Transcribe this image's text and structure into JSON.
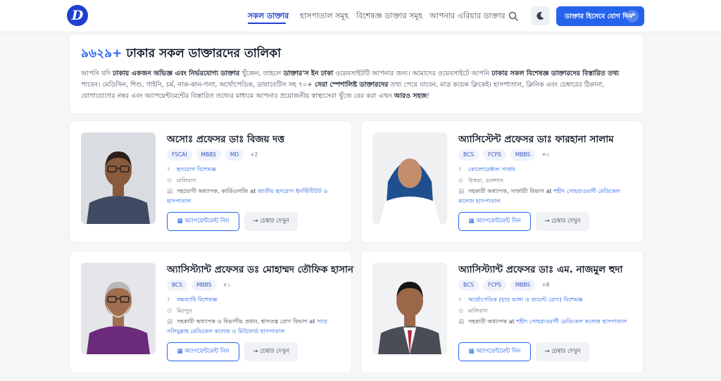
{
  "header": {
    "logo_letter": "D",
    "nav": [
      {
        "label": "সকল ডাক্তার",
        "active": true
      },
      {
        "label": "হাসপাতাল সমূহ",
        "active": false
      },
      {
        "label": "বিশেষজ্ঞ ডাক্তার সমূহ",
        "active": false
      },
      {
        "label": "আপনার এরিয়ার ডাক্তার",
        "active": false
      }
    ],
    "cta_label": "ডাক্তার হিসেবে যোগ দিন",
    "cta_arrow": "↗"
  },
  "hero": {
    "count": "৯৬২৯+",
    "title_rest": " ঢাকার সকল ডাক্তারদের তালিকা",
    "desc": [
      {
        "t": "আপনি যদি ",
        "b": false
      },
      {
        "t": "ঢাকায় একজন অভিজ্ঞ এবং নির্ভরযোগ্য ডাক্তার",
        "b": true
      },
      {
        "t": " খুঁজেন, তাহলে ",
        "b": false
      },
      {
        "t": "ডাক্তার'স ইন ঢাকা",
        "b": true
      },
      {
        "t": " ওয়েবসাইটটি আপনার জন্য। আমাদের ওয়েবসাইটে আপনি ",
        "b": false
      },
      {
        "t": "ঢাকার সকল বিশেষজ্ঞ ডাক্তারদের বিস্তারিত তথ্য",
        "b": true
      },
      {
        "t": " পাবেন। মেডিসিন, শিশু, গাইনি, চর্ম, নাক-কান-গলা, অর্থোপেডিক, ডায়াবেটিস সহ ৭০+ ",
        "b": false
      },
      {
        "t": "সেরা স্পেশালিষ্ট ডাক্তারদের",
        "b": true
      },
      {
        "t": " তথ্য পেয়ে যাবেন, মাত্র কয়েক ক্লিকেই। হাসপাতাল, ক্লিনিক এবং চেম্বারের ঠিকানা, যোগাযোগের নম্বর এবং অ্যাপয়েন্টমেন্টের বিস্তারিত তথ্যের মাধ্যমে আপনার প্রয়োজনীয় স্বাস্থ্যসেবা খুঁজে বের করা এখন ",
        "b": false
      },
      {
        "t": "আরও সহজ",
        "b": true
      },
      {
        "t": "!",
        "b": false
      }
    ]
  },
  "doctors": [
    {
      "name": "অসোঃ প্রফেসর ডাঃ বিজয় দত্ত",
      "badges": [
        "FSCAI",
        "MBBS",
        "MD"
      ],
      "more": "+2",
      "specialty": "হৃদরোগ বিশেষজ্ঞ",
      "location": "মালিবাগ",
      "work_prefix": "সহযোগী অধ্যাপক, কার্ডিওলজি",
      "work_at": " at ",
      "work_inst": "জাতীয় হৃদরোগ ইনস্টিটিউট ও হাসপাতাল",
      "appointment_label": "অ্যাপয়েন্টমেন্ট নিন",
      "chamber_label": "চেম্বার দেখুন",
      "photo": {
        "bg": "#d9dde2",
        "skin": "#8a5a3c",
        "hair": "#2a2018",
        "cloth": "#3f4b63",
        "glasses": true,
        "beard": false,
        "hijab": false,
        "coat": false
      }
    },
    {
      "name": "অ্যাসিস্টেন্ট প্রফেসর ডাঃ ফারহানা সালাম",
      "badges": [
        "BCS",
        "FCPS",
        "MBBS"
      ],
      "more": "+৩",
      "specialty": "কোলোরেক্টাল সার্জন",
      "location": "উত্তরা, গুলশান",
      "work_prefix": "সহকারী অধ্যাপক, সার্জারী বিভাগ",
      "work_at": " at ",
      "work_inst": "শহীদ সোহরাওয়ার্দী মেডিকেল কলেজ হাসপাতাল",
      "appointment_label": "অ্যাপয়েন্টমেন্ট নিন",
      "chamber_label": "চেম্বার দেখুন",
      "photo": {
        "bg": "#eef0f2",
        "skin": "#c48e6c",
        "hair": "#1f4f8f",
        "cloth": "#ffffff",
        "glasses": false,
        "beard": false,
        "hijab": true,
        "coat": true
      }
    },
    {
      "name": "অ্যাসিস্ট্যান্ট প্রফেসর ডঃ মোহাম্মদ তৌফিক হাসান",
      "badges": [
        "BCS",
        "MBBS"
      ],
      "more": "+১",
      "specialty": "বক্ষব্যাধি বিশেষজ্ঞ",
      "location": "মিরপুর",
      "work_prefix": "সহকারী অধ্যাপক ও বিভাগীয় প্রধান, শ্বাসতন্ত্র রোগ বিভাগ",
      "work_at": " at ",
      "work_inst": "স্যার সলিমুল্লাহ মেডিকেল কলেজ ও মিটফোর্ড হাসপাতাল",
      "appointment_label": "অ্যাপয়েন্টমেন্ট নিন",
      "chamber_label": "চেম্বার দেখুন",
      "photo": {
        "bg": "#e4e6e9",
        "skin": "#a06f50",
        "hair": "#b8b8b8",
        "cloth": "#6b2a7a",
        "glasses": true,
        "beard": true,
        "hijab": false,
        "coat": false
      }
    },
    {
      "name": "অ্যাসিস্ট্যান্ট প্রফেসর ডাঃ এম. নাজমুল হুদা",
      "badges": [
        "BCS",
        "FCPS",
        "MBBS"
      ],
      "more": "+8",
      "specialty": "অর্থোপেডিক (হাড় ভাঙ্গা ও জয়েন্ট রোগ) বিশেষজ্ঞ",
      "location": "মালিবাগ",
      "work_prefix": "সহকারী অধ্যাপক",
      "work_at": " at ",
      "work_inst": "শহীদ সোহরাওয়ার্দী মেডিকেল কলেজ হাসপাতাল",
      "appointment_label": "অ্যাপয়েন্টমেন্ট নিন",
      "chamber_label": "চেম্বার দেখুন",
      "photo": {
        "bg": "#f1f2f4",
        "skin": "#9a6848",
        "hair": "#151515",
        "cloth": "#5b5f68",
        "glasses": false,
        "beard": false,
        "hijab": false,
        "coat": true
      }
    }
  ]
}
